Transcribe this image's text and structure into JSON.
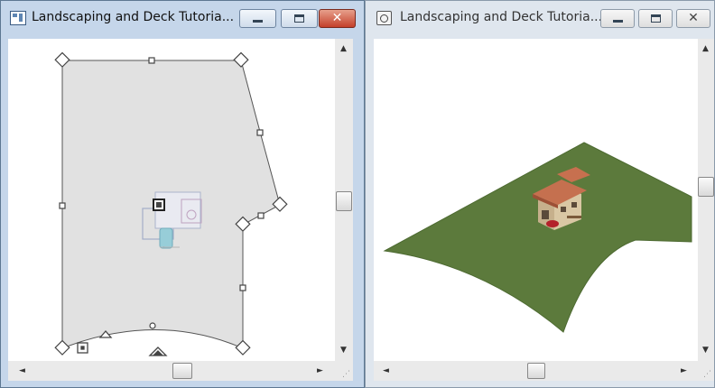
{
  "windows": {
    "plan": {
      "title": "Landscaping and Deck Tutoria...",
      "icon": "floor-plan-icon"
    },
    "camera": {
      "title": "Landscaping and Deck Tutoria...",
      "icon": "camera-view-icon"
    }
  },
  "controls": {
    "minimize": "minimize-icon",
    "maximize": "maximize-icon",
    "close_glyph": "✕"
  },
  "scroll": {
    "up": "▲",
    "down": "▼",
    "left": "◄",
    "right": "►"
  },
  "colors": {
    "terrain_plan": "#e1e1e1",
    "terrain_3d": "#5c7a3c",
    "close_active": "#c4402a"
  }
}
